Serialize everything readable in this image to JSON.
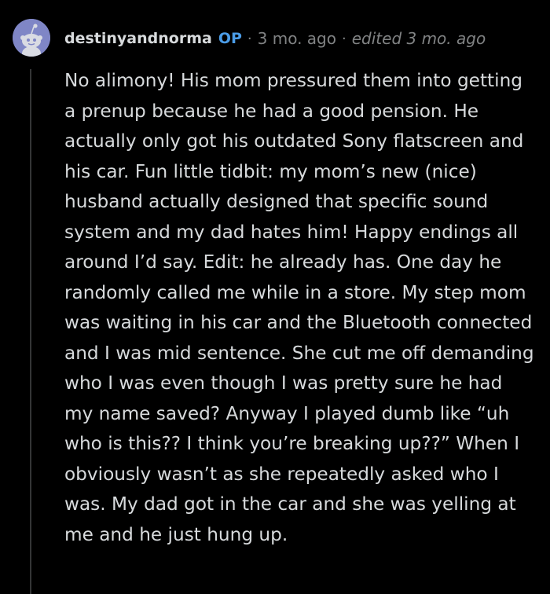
{
  "comment": {
    "author": "destinyandnorma",
    "op_badge": "OP",
    "separator": "·",
    "age": "3 mo. ago",
    "edited": "edited 3 mo. ago",
    "avatar_icon": "reddit-snoo-avatar-icon",
    "body": "No alimony! His mom pressured them into getting a prenup because he had a good pension. He actually only got his outdated Sony flatscreen and his car. Fun little tidbit: my mom’s new (nice) husband actually designed that specific sound system and my dad hates him! Happy endings all around I’d say. Edit: he already has. One day he randomly called me while in a store. My step mom was waiting in his car and the Bluetooth connected and I was mid sentence. She cut me off demanding who I was even though I was pretty sure he had my name saved? Anyway I played dumb like “uh who is this?? I think you’re breaking up??” When I obviously wasn’t as she repeatedly asked who I was. My dad got in the car and she was yelling at me and he just hung up."
  },
  "colors": {
    "background": "#000000",
    "text": "#d7dadc",
    "meta": "#818384",
    "op_badge": "#4b9de8",
    "avatar_bg": "#7f86c6",
    "thread_line": "#343536"
  }
}
